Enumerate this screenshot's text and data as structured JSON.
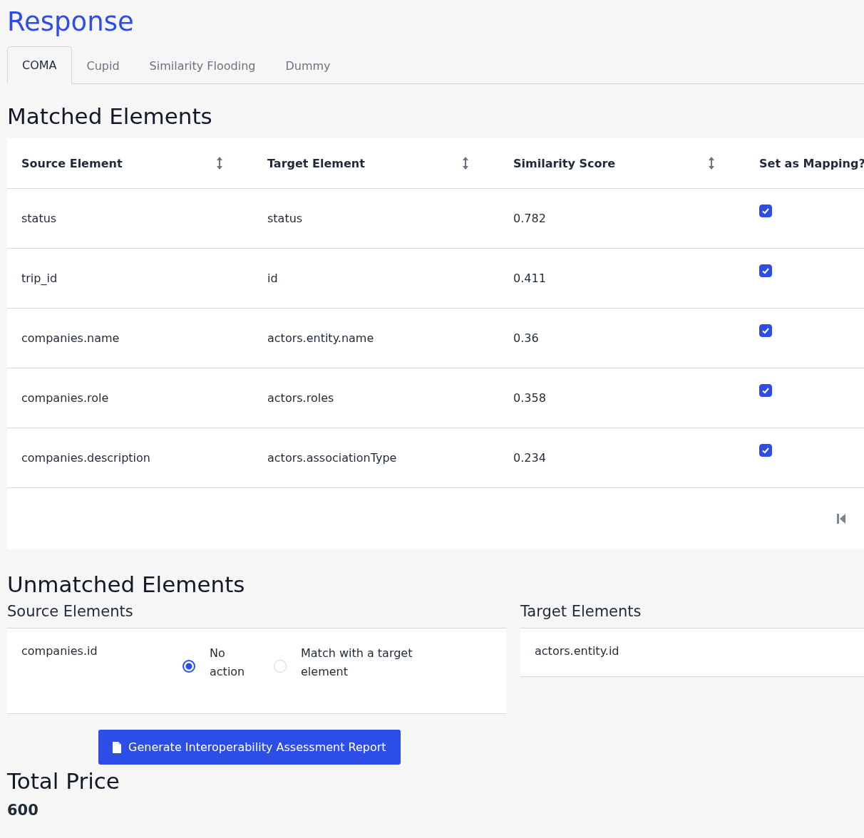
{
  "title": "Response",
  "tabs": [
    {
      "label": "COMA",
      "selected": true
    },
    {
      "label": "Cupid",
      "selected": false
    },
    {
      "label": "Similarity Flooding",
      "selected": false
    },
    {
      "label": "Dummy",
      "selected": false
    }
  ],
  "matched": {
    "heading": "Matched Elements",
    "columns": [
      {
        "label": "Source Element",
        "sortable": true
      },
      {
        "label": "Target Element",
        "sortable": true
      },
      {
        "label": "Similarity Score",
        "sortable": true
      },
      {
        "label": "Set as Mapping?",
        "sortable": false
      }
    ],
    "rows": [
      {
        "source": "status",
        "target": "status",
        "score": "0.782",
        "checked": true
      },
      {
        "source": "trip_id",
        "target": "id",
        "score": "0.411",
        "checked": true
      },
      {
        "source": "companies.name",
        "target": "actors.entity.name",
        "score": "0.36",
        "checked": true
      },
      {
        "source": "companies.role",
        "target": "actors.roles",
        "score": "0.358",
        "checked": true
      },
      {
        "source": "companies.description",
        "target": "actors.associationType",
        "score": "0.234",
        "checked": true
      }
    ]
  },
  "unmatched": {
    "heading": "Unmatched Elements",
    "source": {
      "heading": "Source Elements",
      "items": [
        {
          "name": "companies.id",
          "options": [
            {
              "label": "No action",
              "selected": true
            },
            {
              "label": "Match with a target element",
              "selected": false
            }
          ]
        }
      ]
    },
    "target": {
      "heading": "Target Elements",
      "items": [
        "actors.entity.id"
      ]
    }
  },
  "report_button": "Generate Interoperability Assessment Report",
  "total": {
    "heading": "Total Price",
    "value": "600"
  }
}
